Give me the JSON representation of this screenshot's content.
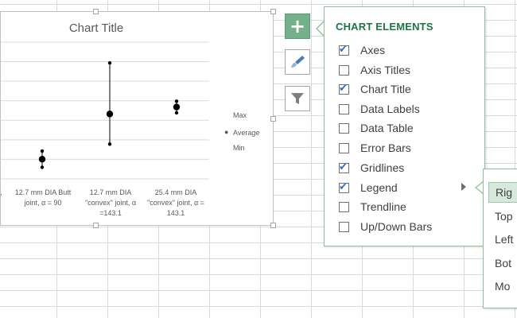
{
  "chart": {
    "title": "Chart Title",
    "categories": [
      "t,",
      "12.7 mm DIA Butt joint, α = 90",
      "12.7 mm DIA \"convex\" joint, α =143.1",
      "25.4 mm DIA \"convex\" joint, α = 143.1"
    ],
    "legend": {
      "max": "Max",
      "average": "Average",
      "min": "Min"
    }
  },
  "chart_data": {
    "type": "scatter",
    "title": "Chart Title",
    "categories": [
      "…t,",
      "12.7 mm DIA Butt joint, α = 90",
      "12.7 mm DIA \"convex\" joint, α =143.1",
      "25.4 mm DIA \"convex\" joint, α = 143.1"
    ],
    "series": [
      {
        "name": "Max",
        "values": [
          null,
          0.24,
          1.0,
          0.67
        ]
      },
      {
        "name": "Average",
        "values": [
          null,
          0.17,
          0.56,
          0.62
        ]
      },
      {
        "name": "Min",
        "values": [
          null,
          0.1,
          0.3,
          0.57
        ]
      }
    ],
    "ylim": [
      0,
      1.18
    ],
    "grid": true,
    "legend_position": "right"
  },
  "side_buttons": [
    {
      "name": "chart-elements-button",
      "icon": "plus-icon"
    },
    {
      "name": "chart-styles-button",
      "icon": "brush-icon"
    },
    {
      "name": "chart-filters-button",
      "icon": "filter-icon"
    }
  ],
  "panel": {
    "header": "CHART ELEMENTS",
    "options": [
      {
        "label": "Axes",
        "checked": true
      },
      {
        "label": "Axis Titles",
        "checked": false
      },
      {
        "label": "Chart Title",
        "checked": true
      },
      {
        "label": "Data Labels",
        "checked": false
      },
      {
        "label": "Data Table",
        "checked": false
      },
      {
        "label": "Error Bars",
        "checked": false
      },
      {
        "label": "Gridlines",
        "checked": true
      },
      {
        "label": "Legend",
        "checked": true
      },
      {
        "label": "Trendline",
        "checked": false
      },
      {
        "label": "Up/Down Bars",
        "checked": false
      }
    ]
  },
  "legend_submenu": {
    "items": [
      "Rig",
      "Top",
      "Left",
      "Bot",
      "Mo"
    ],
    "selected": 0
  },
  "colors": {
    "accent": "#217346",
    "plus_button": "#74b08a",
    "check": "#2d6fba"
  }
}
